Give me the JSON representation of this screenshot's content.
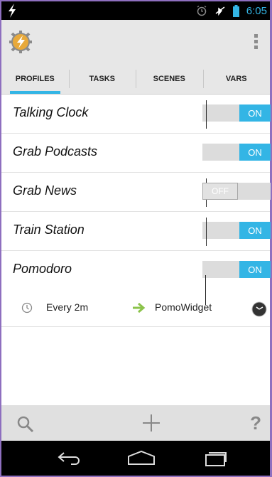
{
  "status_bar": {
    "time": "6:05",
    "icons": [
      "lightning-icon",
      "alarm-icon",
      "airplane-icon",
      "battery-icon"
    ],
    "accent": "#33b5e5"
  },
  "action_bar": {
    "logo_icon": "tasker-logo-icon",
    "overflow_icon": "overflow-menu-icon"
  },
  "tabs": [
    {
      "label": "PROFILES",
      "active": true
    },
    {
      "label": "TASKS",
      "active": false
    },
    {
      "label": "SCENES",
      "active": false
    },
    {
      "label": "VARS",
      "active": false
    }
  ],
  "profiles": [
    {
      "name": "Talking Clock",
      "state": "ON"
    },
    {
      "name": "Grab Podcasts",
      "state": "ON"
    },
    {
      "name": "Grab News",
      "state": "OFF"
    },
    {
      "name": "Train Station",
      "state": "ON"
    },
    {
      "name": "Pomodoro",
      "state": "ON"
    }
  ],
  "expanded_profile": {
    "context_icon": "clock-icon",
    "context_label": "Every 2m",
    "arrow_icon": "arrow-right-icon",
    "task_label": "PomoWidget",
    "task_icon": "clock-widget-icon"
  },
  "bottom_bar": {
    "search_icon": "search-icon",
    "add_icon": "plus-icon",
    "help_label": "?"
  },
  "nav_bar": {
    "icons": [
      "back-icon",
      "home-icon",
      "recents-icon"
    ]
  }
}
